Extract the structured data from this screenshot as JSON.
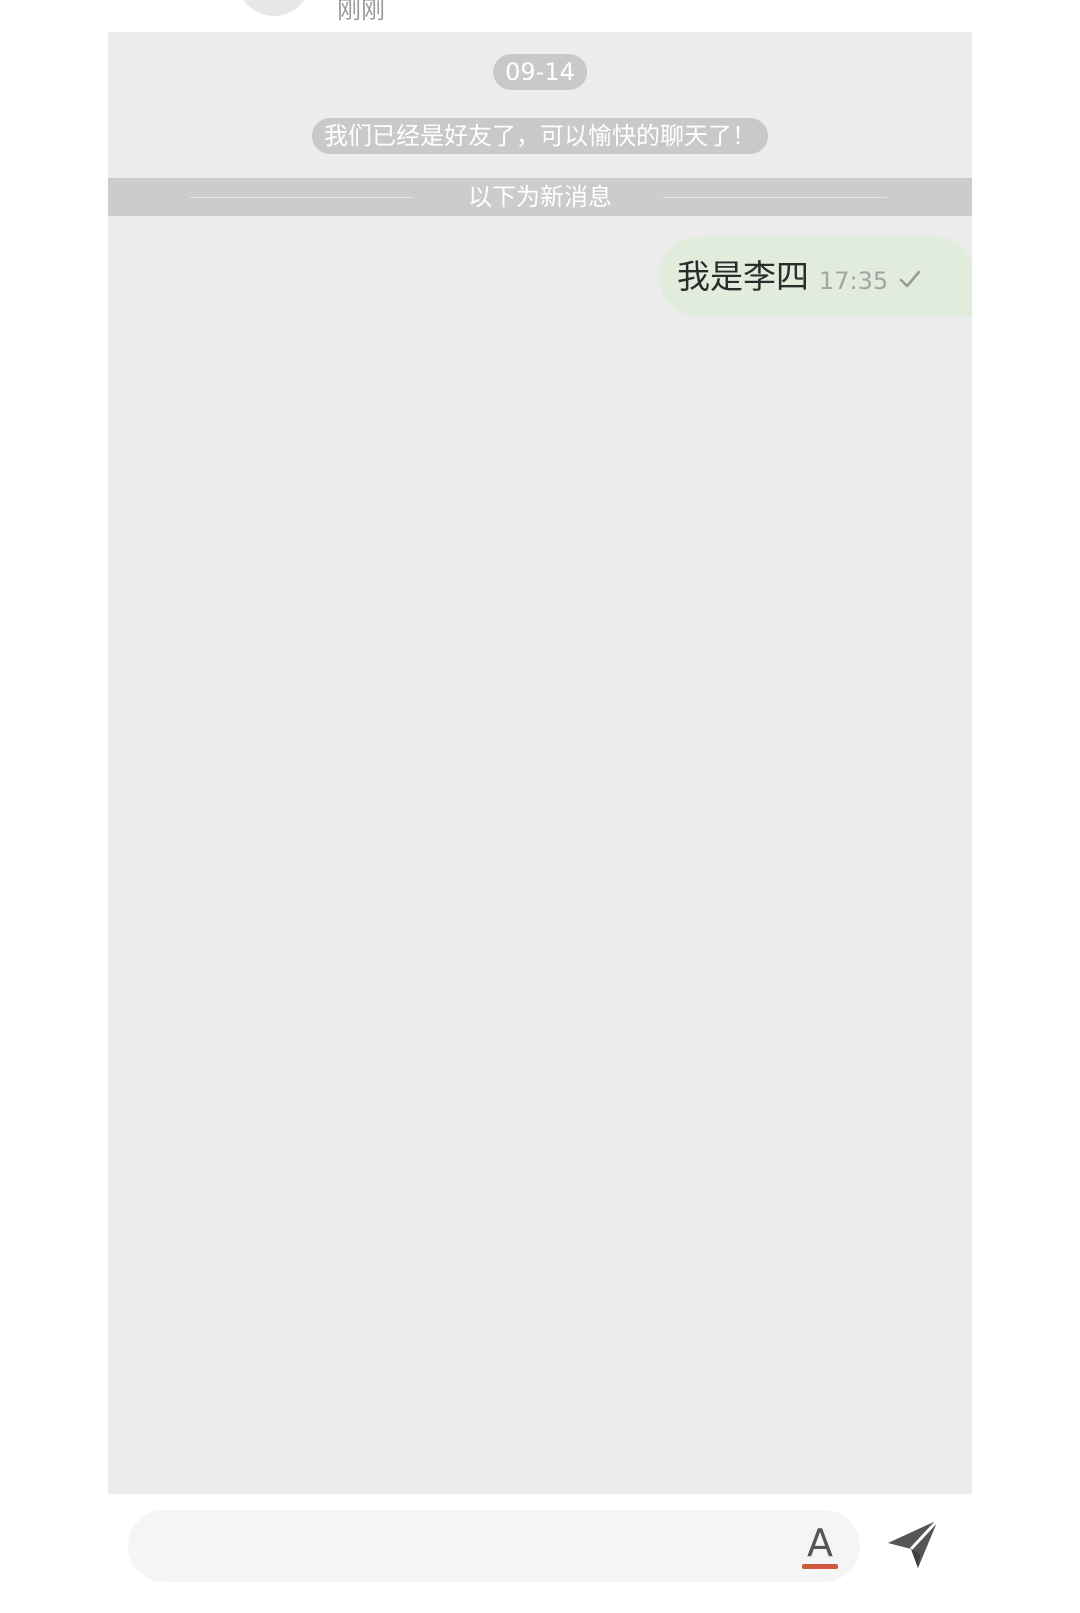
{
  "header": {
    "presence_text": "刚刚"
  },
  "chat": {
    "date_label": "09-14",
    "system_message": "我们已经是好友了，可以愉快的聊天了！",
    "new_messages_divider": "以下为新消息",
    "messages": [
      {
        "direction": "outgoing",
        "text": "我是李四",
        "time": "17:35",
        "status_icon": "check-icon"
      }
    ]
  },
  "composer": {
    "input_value": "",
    "input_placeholder": "",
    "format_button_glyph": "A",
    "format_icon": "text-format-icon",
    "send_icon": "send-icon"
  },
  "colors": {
    "chat_background": "#ececec",
    "pill_background": "#c9c9c9",
    "outgoing_bubble": "#e2ecdd",
    "format_underline": "#d0583c",
    "send_icon": "#555555"
  }
}
